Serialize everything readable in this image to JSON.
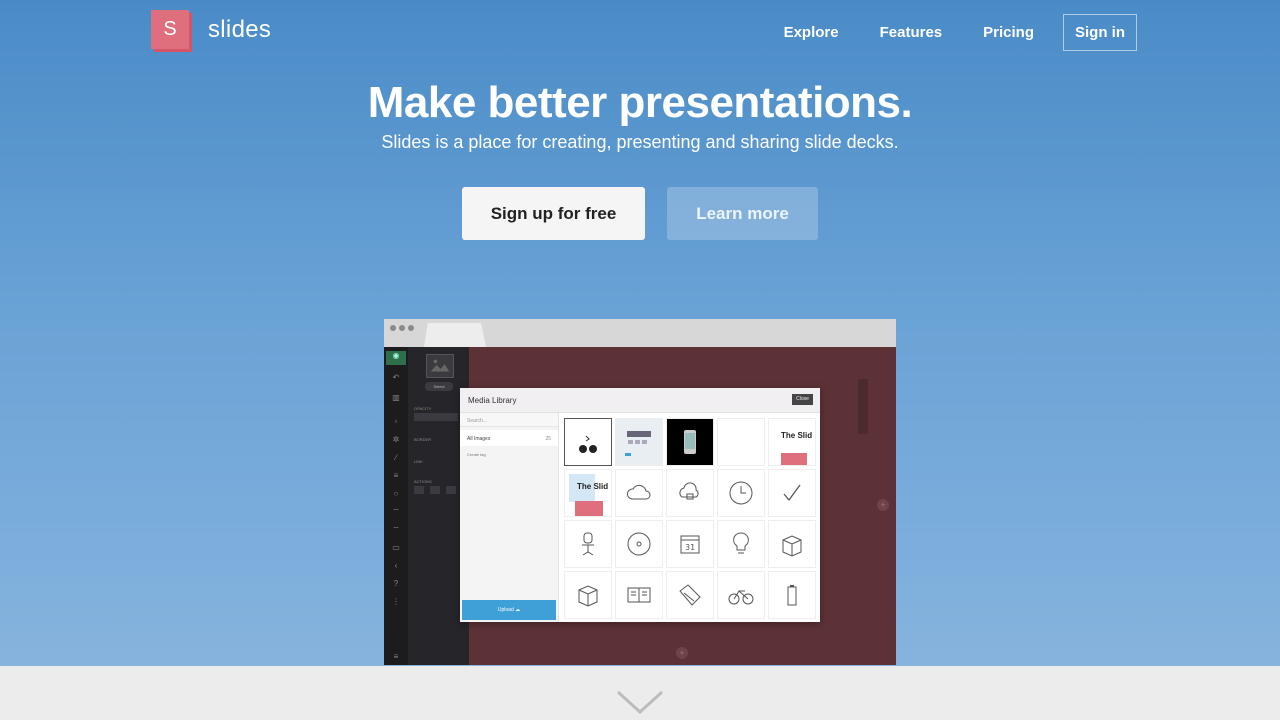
{
  "brand": {
    "logo_letter": "S",
    "name": "slides",
    "accent": "#e06f7e"
  },
  "nav": {
    "items": [
      "Explore",
      "Features",
      "Pricing"
    ],
    "signin": "Sign in"
  },
  "hero": {
    "title": "Make better presentations.",
    "subtitle": "Slides is a place for creating, presenting and sharing slide decks.",
    "signup_label": "Sign up for free",
    "learn_label": "Learn more"
  },
  "editor": {
    "select_label": "Select",
    "panel_labels": [
      "OPACITY",
      "BORDER",
      "LINK",
      "ACTIONS"
    ],
    "media": {
      "title": "Media Library",
      "close_label": "Close",
      "search_placeholder": "Search...",
      "all_images": "All Images",
      "all_count": "25",
      "create_tag": "Create tag",
      "upload_label": "Upload",
      "thumb_text": "The Slid"
    }
  },
  "colors": {
    "canvas": "#5d3237",
    "upload": "#3fa0d8"
  }
}
